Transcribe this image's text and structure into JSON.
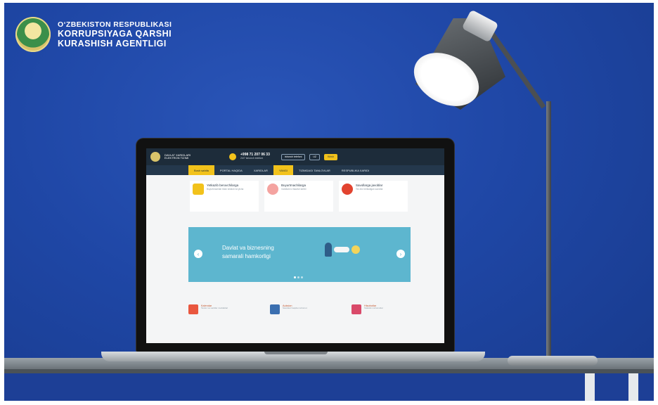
{
  "logo": {
    "line1": "O‘ZBEKISTON RESPUBLIKASI",
    "line2": "KORRUPSIYAGA QARSHI",
    "line3": "KURASHISH AGENTLIGI"
  },
  "screen": {
    "header": {
      "site_name": "DAVLAT XARIDLARI ELEKTRON TIZIMI",
      "phone": "+998 71 207 06 33",
      "phone_note": "24/7 ishonch telefoni",
      "buttons": [
        "Ishonch telefoni",
        "UZ",
        "Kirish"
      ]
    },
    "nav": [
      "Bosh sahifa",
      "PORTAL HAQIDA",
      "XARIDLAR",
      "YANGI",
      "TIZIMDAGI TANLOVLAR",
      "RESPUBLIKA XARIDI"
    ],
    "cards": [
      {
        "title": "Yetkazib beruvchilarga",
        "text": "Buyurtmachilar bilan ishlash bo‘yicha"
      },
      {
        "title": "Buyurtmachilarga",
        "text": "Xaridlarni o‘tkazish tartibi"
      },
      {
        "title": "Savollarga javoblar",
        "text": "Tez-tez beriladigan savollar"
      }
    ],
    "banner": {
      "text": "Davlat va biznesning samarali hamkorligi",
      "prev": "‹",
      "next": "›"
    },
    "footer_items": [
      {
        "title": "Kalendar",
        "text": "Tanlov va xaridlar muddatlari"
      },
      {
        "title": "Auksion",
        "text": "Savdolar haqida ma’lumot"
      },
      {
        "title": "Hisobotlar",
        "text": "Statistik ma’lumotlar"
      }
    ]
  }
}
